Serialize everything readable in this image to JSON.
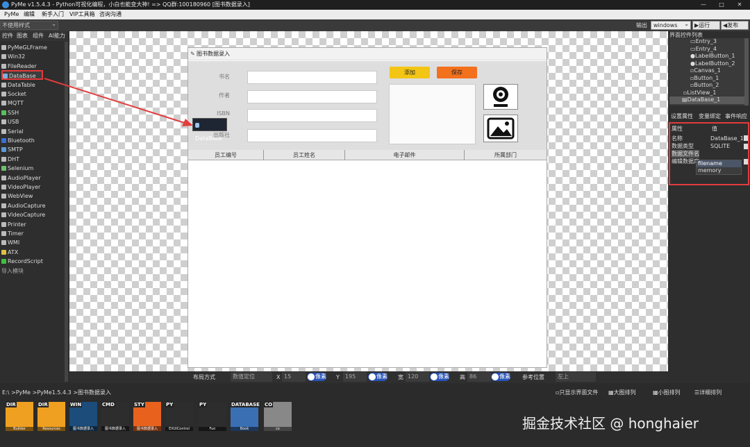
{
  "title": "PyMe v1.5.4.3 - Python可视化编程，小白也能变大神!   => QQ群:100180960   [图书数据录入]",
  "menu": [
    "PyMe",
    "编辑",
    "新手入门",
    "VIP工具箱",
    "咨询沟通"
  ],
  "toolbar": {
    "style_select": "不使用样式",
    "output_label": "输出",
    "output_select": "windows",
    "run_label": "▶运行",
    "publish_label": "◀发布"
  },
  "left_tabs": [
    "控件",
    "图表",
    "组件",
    "AI能力"
  ],
  "controls": [
    "PyMeGLFrame",
    "Win32",
    "FileReader",
    "DataBase",
    "DataTable",
    "Socket",
    "MQTT",
    "SSH",
    "USB",
    "Serial",
    "Bluetooth",
    "SMTP",
    "DHT",
    "Selenium",
    "AudioPlayer",
    "VideoPlayer",
    "WebView",
    "AudioCapture",
    "VideoCapture",
    "Printer",
    "Timer",
    "WMI",
    "ATX",
    "RecordScript",
    "导入模块"
  ],
  "form": {
    "title": "图书数据录入",
    "fields": [
      "书名",
      "作者",
      "ISBN",
      "出版社"
    ],
    "add_button": "添加",
    "save_button": "保存",
    "columns": [
      "员工编号",
      "员工姓名",
      "电子邮件",
      "所属部门"
    ]
  },
  "drag_tip": "DataBase",
  "bottom": {
    "layout_label": "布局方式",
    "layout_value": "数值定位",
    "x_label": "X",
    "x_value": "15",
    "unit1": "像素",
    "y_label": "Y",
    "y_value": "195",
    "unit2": "像素",
    "w_label": "宽",
    "w_value": "120",
    "unit3": "像素",
    "h_label": "高",
    "h_value": "86",
    "unit4": "像素",
    "ref_label": "参考位置",
    "ref_value": "左上"
  },
  "tree": {
    "title": "界面控件列表",
    "items": [
      "Entry_3",
      "Entry_4",
      "LabelButton_1",
      "LabelButton_2",
      "Canvas_1",
      "Button_1",
      "Button_2",
      "ListView_1",
      "DataBase_1"
    ]
  },
  "prop_tabs": [
    "设置属性",
    "变量绑定",
    "事件响应"
  ],
  "props": {
    "header_attr": "属性",
    "header_val": "值",
    "rows": [
      {
        "name": "名称",
        "value": "DataBase_1"
      },
      {
        "name": "数据类型",
        "value": "SQLITE"
      },
      {
        "name": "数据文件名",
        "value": ""
      },
      {
        "name": "编辑数据库",
        "value": ""
      }
    ],
    "dropdown": [
      "filename",
      "memory"
    ]
  },
  "path": "E:\\ >PyMe >PyMe1.5.4.3 >图书数据录入",
  "view_options": [
    "只显示界面文件",
    "大图排列",
    "小图排列",
    "详细排列"
  ],
  "files": [
    {
      "tag": "DIR",
      "name": "Builder",
      "color": "#f0a020"
    },
    {
      "tag": "DIR",
      "name": "Resources",
      "color": "#f0a020"
    },
    {
      "tag": "WIN",
      "name": "图书数据录入",
      "color": "#1b4c7a"
    },
    {
      "tag": "CMD",
      "name": "图书数据录入",
      "color": "#2d2d2d"
    },
    {
      "tag": "STY",
      "name": "图书数据录入",
      "color": "#e8621e"
    },
    {
      "tag": "PY",
      "name": "EXUIControl",
      "color": "#2d2d2d"
    },
    {
      "tag": "PY",
      "name": "Fun",
      "color": "#2d2d2d"
    },
    {
      "tag": "DATABASE",
      "name": "Book",
      "color": "#3a6fb4"
    },
    {
      "tag": "CO",
      "name": "cx",
      "color": "#888888"
    }
  ],
  "watermark": "掘金技术社区 @ honghaier"
}
